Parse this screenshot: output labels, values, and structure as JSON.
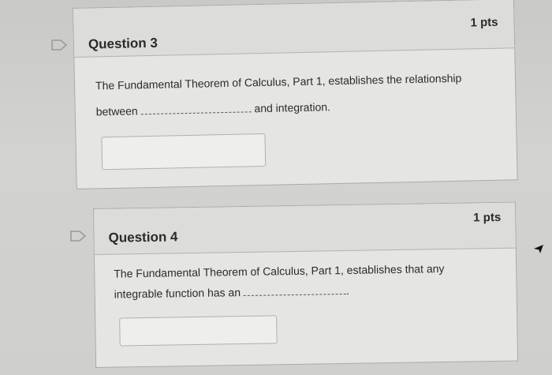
{
  "questions": [
    {
      "title": "Question 3",
      "points": "1 pts",
      "text_line1": "The Fundamental Theorem of Calculus, Part 1, establishes the relationship",
      "text_line2_before": "between",
      "text_line2_after": "and integration.",
      "answer_value": ""
    },
    {
      "title": "Question 4",
      "points": "1 pts",
      "text_line1": "The Fundamental Theorem of Calculus, Part 1, establishes that any",
      "text_line2_before": "integrable function has an",
      "text_line2_after": ".",
      "answer_value": ""
    }
  ],
  "icons": {
    "flag": "flag-question-icon",
    "cursor": "mouse-cursor-icon"
  },
  "colors": {
    "card_background": "#e5e5e3",
    "header_background": "#dcdcda",
    "text": "#2b2b2b"
  }
}
